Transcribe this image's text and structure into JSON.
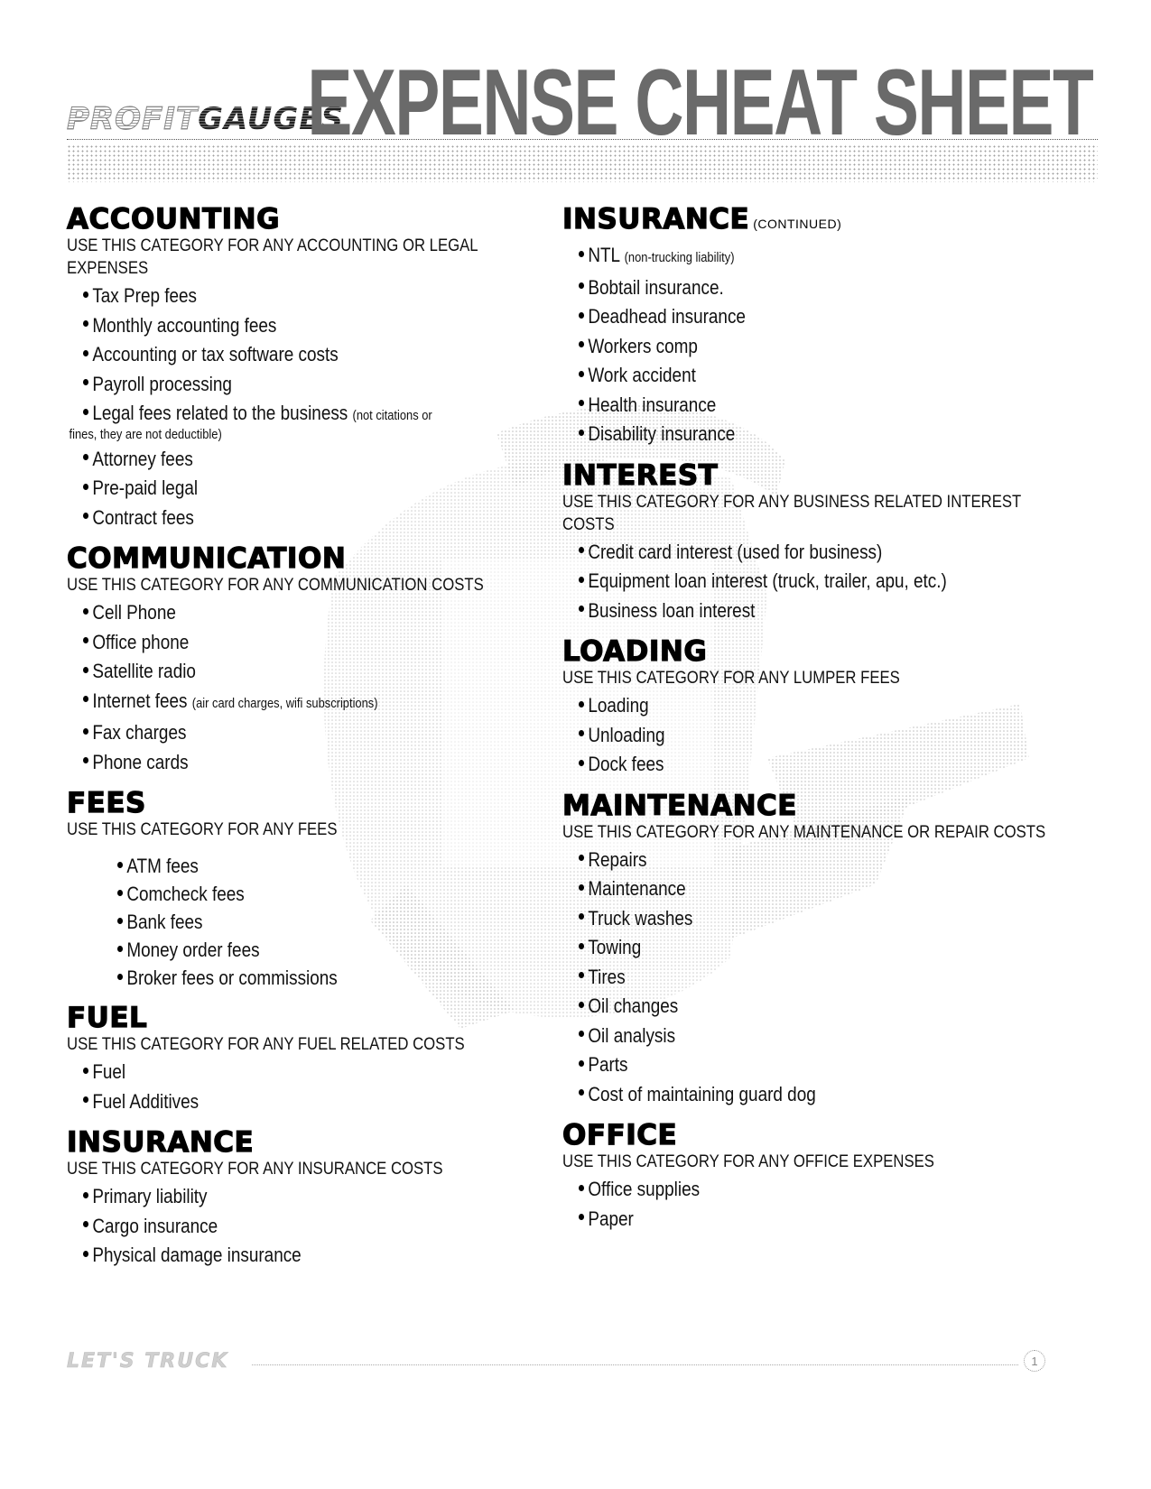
{
  "header": {
    "brand_part1": "PROFIT",
    "brand_part2": "GAUGES",
    "title": "EXPENSE CHEAT SHEET"
  },
  "left_column": [
    {
      "title": "ACCOUNTING",
      "description": "USE THIS CATEGORY FOR ANY ACCOUNTING OR LEGAL EXPENSES",
      "items": [
        {
          "text": "Tax Prep fees"
        },
        {
          "text": "Monthly accounting fees"
        },
        {
          "text": "Accounting or tax software costs"
        },
        {
          "text": "Payroll processing"
        },
        {
          "text": "Legal fees related to the business",
          "note": "(not citations or",
          "note_cont": "fines, they are not deductible)"
        },
        {
          "text": "Attorney fees"
        },
        {
          "text": "Pre-paid legal"
        },
        {
          "text": "Contract fees"
        }
      ]
    },
    {
      "title": "COMMUNICATION",
      "description": "USE THIS CATEGORY FOR ANY COMMUNICATION COSTS",
      "items": [
        {
          "text": "Cell Phone"
        },
        {
          "text": "Office phone"
        },
        {
          "text": "Satellite radio"
        },
        {
          "text": "Internet fees",
          "note": "(air card charges, wifi subscriptions)"
        },
        {
          "text": "Fax charges"
        },
        {
          "text": "Phone cards"
        }
      ]
    },
    {
      "title": "FEES",
      "description": "USE THIS CATEGORY FOR ANY FEES",
      "items": [
        {
          "text": "ATM fees"
        },
        {
          "text": "Comcheck fees"
        },
        {
          "text": "Bank fees"
        },
        {
          "text": "Money order fees"
        },
        {
          "text": "Broker fees or commissions"
        }
      ]
    },
    {
      "title": "FUEL",
      "description": "USE THIS CATEGORY FOR ANY FUEL RELATED COSTS",
      "items": [
        {
          "text": "Fuel"
        },
        {
          "text": "Fuel Additives"
        }
      ]
    },
    {
      "title": "INSURANCE",
      "description": "USE THIS CATEGORY FOR ANY INSURANCE COSTS",
      "items": [
        {
          "text": "Primary liability"
        },
        {
          "text": "Cargo insurance"
        },
        {
          "text": "Physical damage insurance"
        }
      ]
    }
  ],
  "right_column": [
    {
      "title": "INSURANCE",
      "title_suffix": "(CONTINUED)",
      "items": [
        {
          "text": "NTL",
          "note": "(non-trucking liability)"
        },
        {
          "text": "Bobtail insurance."
        },
        {
          "text": "Deadhead insurance"
        },
        {
          "text": "Workers comp"
        },
        {
          "text": "Work accident"
        },
        {
          "text": "Health insurance"
        },
        {
          "text": "Disability insurance"
        }
      ]
    },
    {
      "title": "INTEREST",
      "description": "USE THIS CATEGORY FOR ANY BUSINESS RELATED INTEREST COSTS",
      "items": [
        {
          "text": "Credit card interest (used for business)"
        },
        {
          "text": "Equipment loan interest (truck, trailer, apu, etc.)"
        },
        {
          "text": "Business loan interest"
        }
      ]
    },
    {
      "title": "LOADING",
      "description": "USE THIS CATEGORY FOR ANY LUMPER FEES",
      "items": [
        {
          "text": "Loading"
        },
        {
          "text": "Unloading"
        },
        {
          "text": "Dock fees"
        }
      ]
    },
    {
      "title": "MAINTENANCE",
      "description": "USE THIS CATEGORY FOR ANY MAINTENANCE OR REPAIR COSTS",
      "items": [
        {
          "text": "Repairs"
        },
        {
          "text": "Maintenance"
        },
        {
          "text": "Truck washes"
        },
        {
          "text": "Towing"
        },
        {
          "text": "Tires"
        },
        {
          "text": "Oil changes"
        },
        {
          "text": "Oil analysis"
        },
        {
          "text": "Parts"
        },
        {
          "text": "Cost of maintaining guard dog"
        }
      ]
    },
    {
      "title": "OFFICE",
      "description": "USE THIS CATEGORY FOR ANY OFFICE EXPENSES",
      "items": [
        {
          "text": "Office supplies"
        },
        {
          "text": "Paper"
        }
      ]
    }
  ],
  "footer": {
    "logo_text": "LET'S TRUCK",
    "page_number": "1"
  }
}
